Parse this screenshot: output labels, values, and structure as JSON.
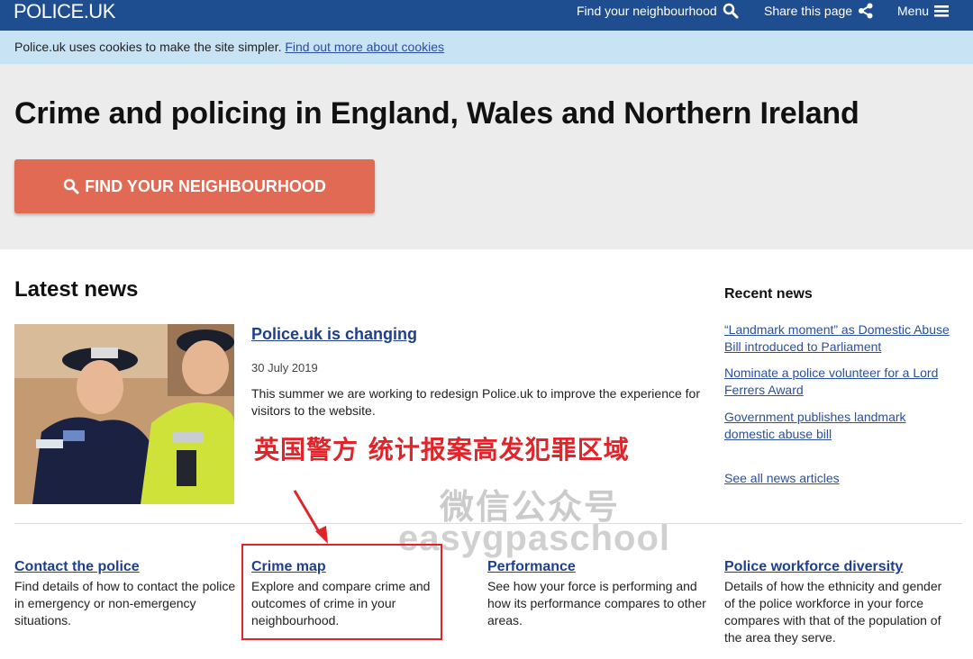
{
  "header": {
    "logo": "POLICE.UK",
    "nav": {
      "find": "Find your neighbourhood",
      "share": "Share this page",
      "menu": "Menu"
    }
  },
  "cookies": {
    "text": "Police.uk uses cookies to make the site simpler. ",
    "link": "Find out more about cookies"
  },
  "hero": {
    "title": "Crime and policing in England, Wales and Northern Ireland",
    "button": "FIND YOUR NEIGHBOURHOOD"
  },
  "latest": {
    "heading": "Latest news",
    "article": {
      "title": "Police.uk is changing",
      "date": "30 July 2019",
      "body": "This summer we are working to redesign Police.uk to improve the experience for visitors to the website."
    }
  },
  "overlay": {
    "caption": "英国警方 统计报案高发犯罪区域",
    "watermark_cn": "微信公众号",
    "watermark_en": "easygpaschool"
  },
  "recent": {
    "heading": "Recent news",
    "items": [
      "“Landmark moment” as Domestic Abuse Bill introduced to Parliament",
      "Nominate a police volunteer for a Lord Ferrers Award",
      "Government publishes landmark domestic abuse bill"
    ],
    "see_all": "See all news articles"
  },
  "columns": [
    {
      "title": "Contact the police",
      "desc": "Find details of how to contact the police in emergency or non-emergency situations."
    },
    {
      "title": "Crime map",
      "desc": "Explore and compare crime and outcomes of crime in your neighbourhood."
    },
    {
      "title": "Performance",
      "desc": "See how your force is performing and how its performance compares to other areas."
    },
    {
      "title": "Police workforce diversity",
      "desc": "Details of how the ethnicity and gender of the police workforce in your force compares with that of the population of the area they serve."
    }
  ],
  "colors": {
    "header_bg": "#1e4e8f",
    "cookie_bg": "#c8e3f4",
    "hero_bg": "#ececec",
    "button_bg": "#e06a53",
    "link": "#1e3f8a",
    "annotation": "#e0252a"
  }
}
